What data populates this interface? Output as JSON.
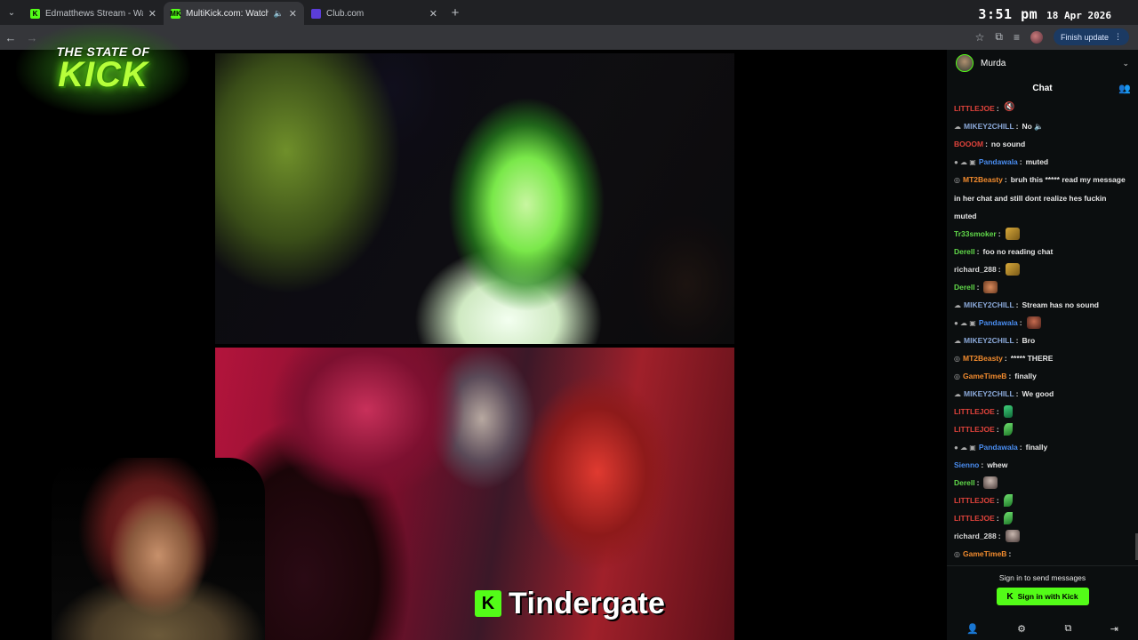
{
  "browser": {
    "tabs": [
      {
        "title": "Edmatthews Stream - Watch Li",
        "favicon": "K",
        "favicon_color": "#53fc18",
        "active": false
      },
      {
        "title": "MultiKick.com: Watch Mult",
        "favicon": "MK",
        "favicon_color": "#53fc18",
        "active": true
      },
      {
        "title": "Club.com",
        "favicon": "",
        "favicon_color": "#5b3dd9",
        "active": false
      }
    ],
    "clock_time": "3:51 pm",
    "clock_date": "18 Apr 2026",
    "finish_update": "Finish update"
  },
  "overlay": {
    "logo_small": "THE STATE OF",
    "logo_big": "KICK",
    "caption_badge": "K",
    "caption_text": "Tindergate"
  },
  "chat": {
    "channel_name": "Murda",
    "title": "Chat",
    "messages": [
      {
        "prefix": "",
        "user": "LITTLEJOE",
        "color": "#e0433b",
        "text": "",
        "emote": "mute"
      },
      {
        "prefix": "☁",
        "user": "MIKEY2CHILL",
        "color": "#8aa8d8",
        "text": "No 🔈",
        "emote": ""
      },
      {
        "prefix": "",
        "user": "BOOOM",
        "color": "#e0433b",
        "text": "no sound",
        "emote": ""
      },
      {
        "prefix": "● ☁ ▣",
        "user": "Pandawala",
        "color": "#4a8df0",
        "text": "muted",
        "emote": ""
      },
      {
        "prefix": "◎",
        "user": "MT2Beasty",
        "color": "#f28b2e",
        "text": "bruh this ***** read my message in her chat and still dont realize hes fuckin muted",
        "emote": ""
      },
      {
        "prefix": "",
        "user": "Tr33smoker",
        "color": "#61d94a",
        "text": "",
        "emote": "cat"
      },
      {
        "prefix": "",
        "user": "Derell",
        "color": "#61d94a",
        "text": "foo no reading chat",
        "emote": ""
      },
      {
        "prefix": "",
        "user": "richard_288",
        "color": "#d8d8d8",
        "text": "",
        "emote": "cat"
      },
      {
        "prefix": "",
        "user": "Derell",
        "color": "#61d94a",
        "text": "",
        "emote": "face"
      },
      {
        "prefix": "☁",
        "user": "MIKEY2CHILL",
        "color": "#8aa8d8",
        "text": "Stream has no sound",
        "emote": ""
      },
      {
        "prefix": "● ☁ ▣",
        "user": "Pandawala",
        "color": "#4a8df0",
        "text": "",
        "emote": "girl"
      },
      {
        "prefix": "☁",
        "user": "MIKEY2CHILL",
        "color": "#8aa8d8",
        "text": "Bro",
        "emote": ""
      },
      {
        "prefix": "◎",
        "user": "MT2Beasty",
        "color": "#f28b2e",
        "text": "***** THERE",
        "emote": ""
      },
      {
        "prefix": "◎",
        "user": "GameTimeB",
        "color": "#f28b2e",
        "text": "finally",
        "emote": ""
      },
      {
        "prefix": "☁",
        "user": "MIKEY2CHILL",
        "color": "#8aa8d8",
        "text": "We good",
        "emote": ""
      },
      {
        "prefix": "",
        "user": "LITTLEJOE",
        "color": "#e0433b",
        "text": "",
        "emote": "hand"
      },
      {
        "prefix": "",
        "user": "LITTLEJOE",
        "color": "#e0433b",
        "text": "",
        "emote": "leaf"
      },
      {
        "prefix": "● ☁ ▣",
        "user": "Pandawala",
        "color": "#4a8df0",
        "text": "finally",
        "emote": ""
      },
      {
        "prefix": "",
        "user": "Sienno",
        "color": "#4a8df0",
        "text": "whew",
        "emote": ""
      },
      {
        "prefix": "",
        "user": "Derell",
        "color": "#61d94a",
        "text": "",
        "emote": "man"
      },
      {
        "prefix": "",
        "user": "LITTLEJOE",
        "color": "#e0433b",
        "text": "",
        "emote": "leaf"
      },
      {
        "prefix": "",
        "user": "LITTLEJOE",
        "color": "#e0433b",
        "text": "",
        "emote": "leaf"
      },
      {
        "prefix": "",
        "user": "richard_288",
        "color": "#d8d8d8",
        "text": "",
        "emote": "man"
      },
      {
        "prefix": "◎",
        "user": "GameTimeB",
        "color": "#f28b2e",
        "text": "",
        "emote": ""
      }
    ],
    "signin_prompt": "Sign in to send messages",
    "signin_button": "Sign in with Kick",
    "kick_green": "#53fc18"
  }
}
